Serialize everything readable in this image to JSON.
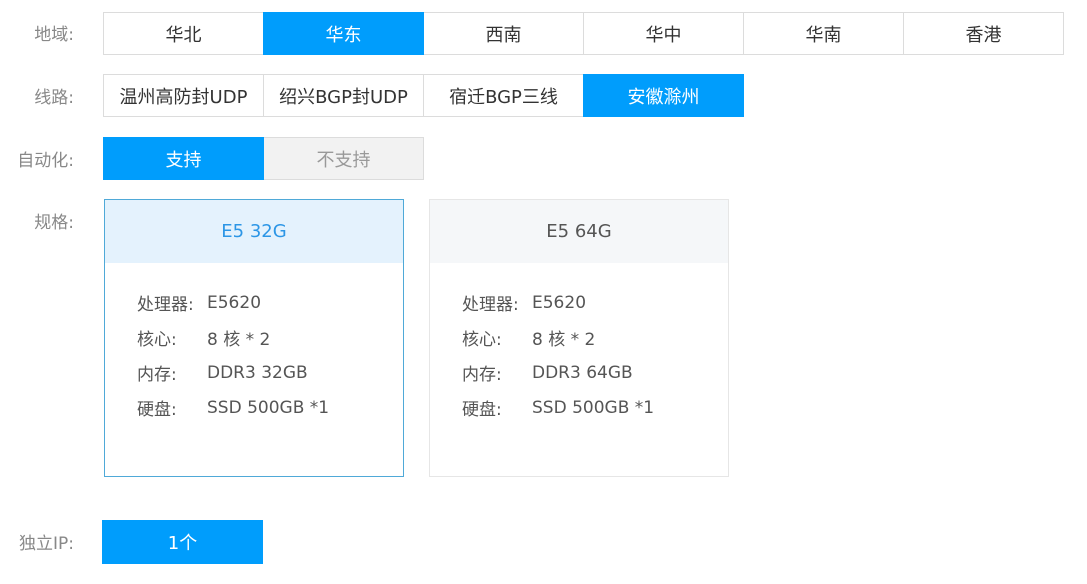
{
  "region": {
    "label": "地域:",
    "options": [
      "华北",
      "华东",
      "西南",
      "华中",
      "华南",
      "香港"
    ],
    "selected": "华东"
  },
  "line": {
    "label": "线路:",
    "options": [
      "温州高防封UDP",
      "绍兴BGP封UDP",
      "宿迁BGP三线",
      "安徽滁州"
    ],
    "selected": "安徽滁州"
  },
  "automation": {
    "label": "自动化:",
    "options": [
      "支持",
      "不支持"
    ],
    "selected": "支持"
  },
  "spec": {
    "label": "规格:",
    "cards": [
      {
        "title": "E5 32G",
        "selected": true,
        "rows": [
          {
            "key": "处理器:",
            "value": "E5620"
          },
          {
            "key": "核心:",
            "value": "8 核 * 2"
          },
          {
            "key": "内存:",
            "value": "DDR3 32GB"
          },
          {
            "key": "硬盘:",
            "value": "SSD 500GB *1"
          }
        ]
      },
      {
        "title": "E5 64G",
        "selected": false,
        "rows": [
          {
            "key": "处理器:",
            "value": "E5620"
          },
          {
            "key": "核心:",
            "value": "8 核 * 2"
          },
          {
            "key": "内存:",
            "value": "DDR3 64GB"
          },
          {
            "key": "硬盘:",
            "value": "SSD 500GB *1"
          }
        ]
      }
    ]
  },
  "ip": {
    "label": "独立IP:",
    "value": "1个"
  },
  "colors": {
    "accent": "#009dfc",
    "selected_card_border": "#4fa9d8",
    "selected_card_header": "#e4f2fd"
  }
}
